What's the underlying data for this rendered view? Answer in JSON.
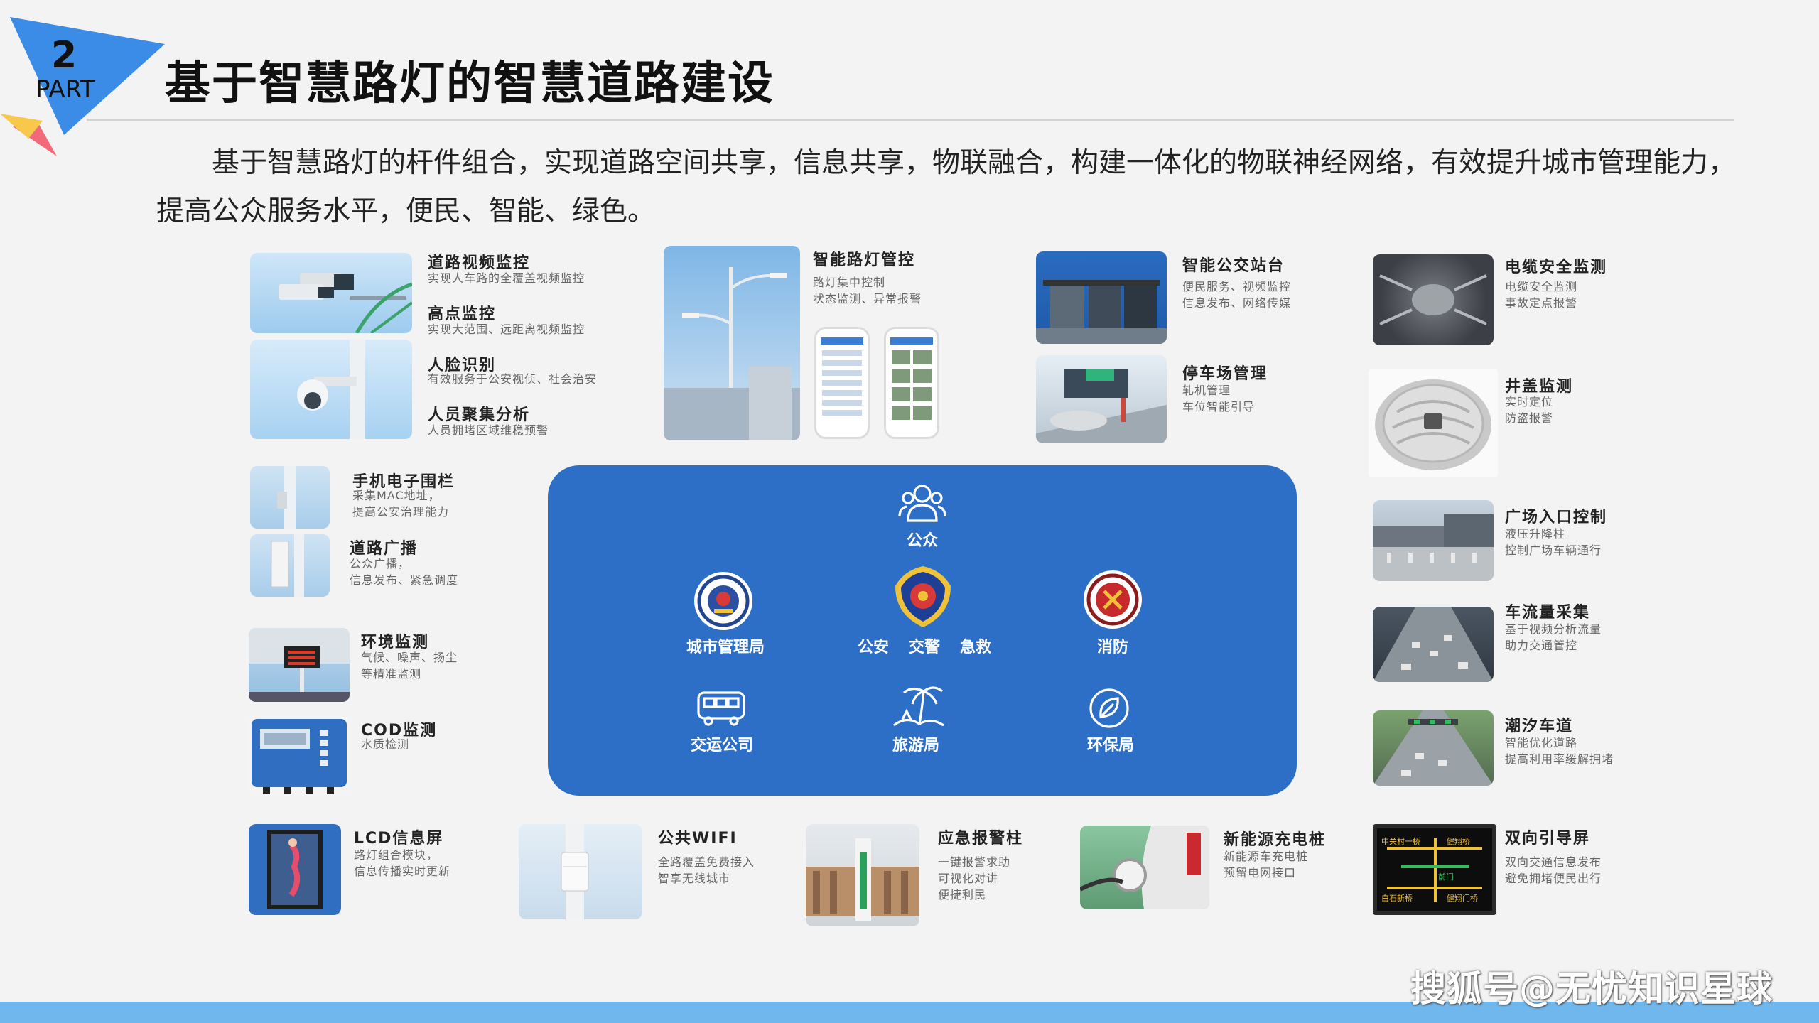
{
  "part_badge": {
    "number": "2",
    "label": "PART"
  },
  "title": "基于智慧路灯的智慧道路建设",
  "intro": "基于智慧路灯的杆件组合，实现道路空间共享，信息共享，物联融合，构建一体化的物联神经网络，有效提升城市管理能力，提高公众服务水平，便民、智能、绿色。",
  "features": {
    "video": {
      "title": "道路视频监控",
      "desc": [
        "实现人车路的全覆盖视频监控"
      ]
    },
    "high": {
      "title": "高点监控",
      "desc": [
        "实现大范围、远距离视频监控"
      ]
    },
    "face": {
      "title": "人脸识别",
      "desc": [
        "有效服务于公安视侦、社会治安"
      ]
    },
    "crowd": {
      "title": "人员聚集分析",
      "desc": [
        "人员拥堵区域维稳预警"
      ]
    },
    "lamp": {
      "title": "智能路灯管控",
      "desc": [
        "路灯集中控制",
        "状态监测、异常报警"
      ]
    },
    "bus": {
      "title": "智能公交站台",
      "desc": [
        "便民服务、视频监控",
        "信息发布、网络传媒"
      ]
    },
    "parking": {
      "title": "停车场管理",
      "desc": [
        "轧机管理",
        "车位智能引导"
      ]
    },
    "cable": {
      "title": "电缆安全监测",
      "desc": [
        "电缆安全监测",
        "事故定点报警"
      ]
    },
    "manhole": {
      "title": "井盖监测",
      "desc": [
        "实时定位",
        "防盗报警"
      ]
    },
    "fence": {
      "title": "手机电子围栏",
      "desc": [
        "采集MAC地址，",
        "提高公安治理能力"
      ]
    },
    "broadcast": {
      "title": "道路广播",
      "desc": [
        "公众广播，",
        "信息发布、紧急调度"
      ]
    },
    "env": {
      "title": "环境监测",
      "desc": [
        "气候、噪声、扬尘",
        "等精准监测"
      ]
    },
    "cod": {
      "title": "COD监测",
      "desc": [
        "水质检测"
      ]
    },
    "plaza": {
      "title": "广场入口控制",
      "desc": [
        "液压升降柱",
        "控制广场车辆通行"
      ]
    },
    "traffic": {
      "title": "车流量采集",
      "desc": [
        "基于视频分析流量",
        "助力交通管控"
      ]
    },
    "tidal": {
      "title": "潮汐车道",
      "desc": [
        "智能优化道路",
        "提高利用率缓解拥堵"
      ]
    },
    "lcd": {
      "title": "LCD信息屏",
      "desc": [
        "路灯组合模块，",
        "信息传播实时更新"
      ]
    },
    "wifi": {
      "title": "公共WIFI",
      "desc": [
        "全路覆盖免费接入",
        "智享无线城市"
      ]
    },
    "alarm": {
      "title": "应急报警柱",
      "desc": [
        "一键报警求助",
        "可视化对讲",
        "便捷利民"
      ]
    },
    "ev": {
      "title": "新能源充电桩",
      "desc": [
        "新能源车充电桩",
        "预留电网接口"
      ]
    },
    "guide": {
      "title": "双向引导屏",
      "desc": [
        "双向交通信息发布",
        "避免拥堵便民出行"
      ]
    }
  },
  "hub": {
    "public": "公众",
    "city": "城市管理局",
    "police": "公安",
    "traffic_police": "交警",
    "emergency": "急救",
    "fire": "消防",
    "transport": "交运公司",
    "tourism": "旅游局",
    "environment": "环保局"
  },
  "guide_screen_text": [
    "中关村一桥",
    "健翔桥",
    "前门",
    "白石新桥",
    "健翔门桥"
  ],
  "watermark": "搜狐号@无忧知识星球",
  "colors": {
    "accent_blue": "#2d6ec6",
    "badge_blue": "#3b8ce6",
    "badge_yellow": "#f7c84a",
    "badge_red": "#f06a7a",
    "footer_blue": "#6fb7ec"
  }
}
